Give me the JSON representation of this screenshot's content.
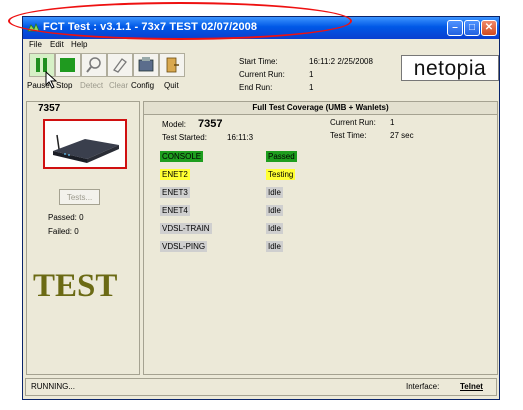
{
  "window": {
    "title": "FCT Test : v3.1.1 - 73x7 TEST 02/07/2008",
    "controls": {
      "minimize": "–",
      "maximize": "□",
      "close": "✕"
    }
  },
  "menu": [
    "File",
    "Edit",
    "Help"
  ],
  "toolbar": {
    "buttons": [
      {
        "label": "Pause",
        "icon": "pause-icon",
        "enabled": true
      },
      {
        "label": "Stop",
        "icon": "stop-icon",
        "enabled": true
      },
      {
        "label": "Detect",
        "icon": "detect-icon",
        "enabled": false
      },
      {
        "label": "Clear",
        "icon": "clear-icon",
        "enabled": false
      },
      {
        "label": "Config",
        "icon": "config-icon",
        "enabled": true
      },
      {
        "label": "Quit",
        "icon": "quit-icon",
        "enabled": true
      }
    ]
  },
  "run_info": {
    "start_label": "Start Time:",
    "start_value": "16:11:2 2/25/2008",
    "current_label": "Current Run:",
    "current_value": "1",
    "end_label": "End Run:",
    "end_value": "1"
  },
  "logo_text": "netopia",
  "left_panel": {
    "device_id": "7357",
    "tests_button": "Tests...",
    "passed": "Passed: 0",
    "failed": "Failed: 0",
    "mode_text": "TEST"
  },
  "right_panel": {
    "header": "Full Test Coverage (UMB + Wanlets)",
    "model_label": "Model:",
    "model_value": "7357",
    "started_label": "Test Started:",
    "started_value": "16:11:3",
    "current_run_label": "Current Run:",
    "current_run_value": "1",
    "test_time_label": "Test Time:",
    "test_time_value": "27 sec",
    "tests": [
      {
        "name": "CONSOLE",
        "status": "Passed"
      },
      {
        "name": "ENET2",
        "status": "Testing"
      },
      {
        "name": "ENET3",
        "status": "Idle"
      },
      {
        "name": "ENET4",
        "status": "Idle"
      },
      {
        "name": "VDSL-TRAIN",
        "status": "Idle"
      },
      {
        "name": "VDSL-PING",
        "status": "Idle"
      }
    ]
  },
  "status_bar": {
    "state": "RUNNING...",
    "interface_label": "Interface:",
    "interface_value": "Telnet"
  },
  "colors": {
    "passed": "#1e9e1e",
    "testing": "#ffff33",
    "idle": "#cfcfcf",
    "test_text": "#6b6a14",
    "annotation": "#e11111",
    "title_bar": "#0a58e6"
  }
}
